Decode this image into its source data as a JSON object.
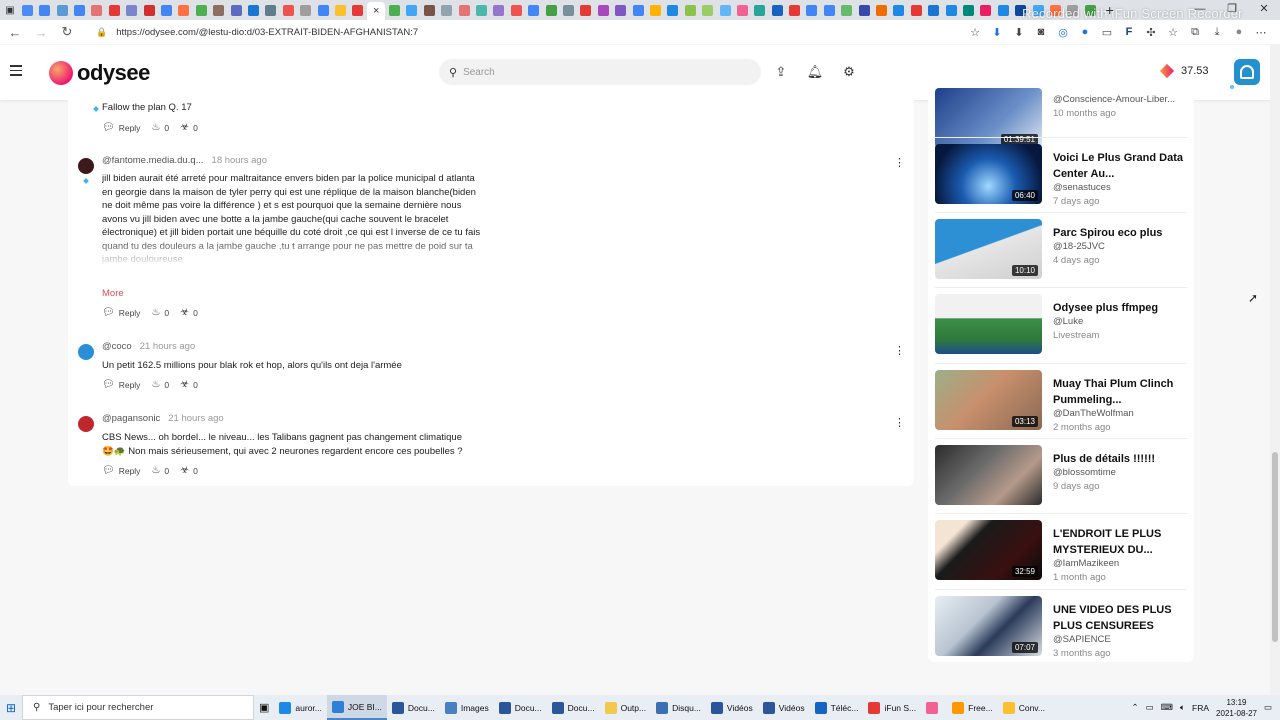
{
  "browser": {
    "tab_colors": [
      "#4c8bf5",
      "#4285f4",
      "#5b9bd5",
      "#4285f4",
      "#e57373",
      "#e53935",
      "#7986cb",
      "#d32f2f",
      "#4285f4",
      "#ff7043",
      "#4caf50",
      "#8d6e63",
      "#5c6bc0",
      "#1976d2",
      "#607d8b",
      "#ef5350",
      "#9e9e9e",
      "#4285f4",
      "#fbc02d",
      "#e53935",
      "#4caf50",
      "#42a5f5",
      "#795548",
      "#90a4ae",
      "#e57373",
      "#4db6ac",
      "#9575cd",
      "#ef5350",
      "#4285f4",
      "#43a047",
      "#78909c",
      "#e53935",
      "#ab47bc",
      "#7e57c2",
      "#4285f4",
      "#ffb300",
      "#1e88e5",
      "#8bc34a",
      "#9ccc65",
      "#64b5f6",
      "#f06292",
      "#26a69a",
      "#1565c0",
      "#e53935",
      "#4285f4",
      "#4285f4",
      "#66bb6a",
      "#3949ab",
      "#ef6c00",
      "#1e88e5",
      "#e53935",
      "#1976d2",
      "#1e88e5",
      "#00897b",
      "#e91e63",
      "#1e88e5",
      "#0d47a1",
      "#42a5f5",
      "#ff7043",
      "#9e9e9e",
      "#43a047"
    ],
    "tab_close": "×",
    "new_tab": "+",
    "recorder_watermark": "Recorded with iFun Screen Recorder",
    "url": "https://odysee.com/@lestu-dio:d/03-EXTRAIT-BIDEN-AFGHANISTAN:7",
    "window_controls": [
      "—",
      "❐",
      "✕"
    ]
  },
  "header": {
    "logo_text": "odysee",
    "search_placeholder": "Search",
    "credits": "37.53"
  },
  "comments": [
    {
      "author": "",
      "time": "",
      "text": "Fallow the plan Q. 17",
      "reply_label": "Reply",
      "likes": "0",
      "dislikes": "0"
    },
    {
      "author": "@fantome.media.du.q...",
      "time": "18 hours ago",
      "text": "jill biden aurait été arreté pour maltraitance envers biden par la police municipal d atlanta en georgie dans la maison de tyler perry qui est une réplique de la maison blanche(biden ne doit même pas voire la différence ) et s est pourquoi que la semaine dernière nous avons vu jill biden avec une botte a la jambe gauche(qui cache souvent le bracelet électronique) et jill biden portait une béquille du coté droit ,ce qui est l inverse de ce tu fais quand tu des douleurs a la jambe gauche ,tu t arrange pour ne pas mettre de poid sur ta jambe douloureuse",
      "more_label": "More",
      "reply_label": "Reply",
      "likes": "0",
      "dislikes": "0",
      "avatar_color": "#3a1a1a"
    },
    {
      "author": "@coco",
      "time": "21 hours ago",
      "text": "Un petit 162.5 millions pour blak rok et hop, alors qu'ils ont deja l'armée",
      "reply_label": "Reply",
      "likes": "0",
      "dislikes": "0",
      "avatar_color": "#2a8fd8"
    },
    {
      "author": "@pagansonic",
      "time": "21 hours ago",
      "text_line1": "CBS News... oh bordel... le niveau... les Talibans gagnent pas changement climatique",
      "text_line2": "🤩🐢 Non mais sérieusement, qui avec 2 neurones regardent encore ces poubelles ?",
      "reply_label": "Reply",
      "likes": "0",
      "dislikes": "0",
      "avatar_color": "#c0262d"
    }
  ],
  "related": [
    {
      "title": "",
      "channel": "@Conscience-Amour-Liber...",
      "age": "10 months ago",
      "duration": "01:39:51",
      "thumb": "linear-gradient(135deg,#1e3f8a,#6a8fc8 60%,#dfe6f1)"
    },
    {
      "title": "Voici Le Plus Grand Data Center Au...",
      "channel": "@senastuces",
      "age": "7 days ago",
      "duration": "06:40",
      "thumb": "radial-gradient(circle at 50% 70%,#9fd8ff,#1a5bb0 40%,#07183e 80%)"
    },
    {
      "title": "Parc Spirou eco plus",
      "channel": "@18-25JVC",
      "age": "4 days ago",
      "duration": "10:10",
      "thumb": "linear-gradient(160deg,#2d8fd4 45%,#e6e6e6 46%,#cfcfcf)"
    },
    {
      "title": "Odysee plus ffmpeg",
      "channel": "@Luke",
      "age": "Livestream",
      "duration": "",
      "thumb": "linear-gradient(180deg,#f1f1f1 40%,#3a8f46 41%,#2f7a3a 75%,#1c4f8a)"
    },
    {
      "title": "Muay Thai Plum Clinch Pummeling...",
      "channel": "@DanTheWolfman",
      "age": "2 months ago",
      "duration": "03:13",
      "thumb": "linear-gradient(135deg,#9bb08a,#c98f6c 45%,#8a6a55)"
    },
    {
      "title": "Plus de détails !!!!!!",
      "channel": "@blossomtime",
      "age": "9 days ago",
      "duration": "",
      "thumb": "linear-gradient(135deg,#2b2b2b,#6b6b6b 40%,#b59a8a 70%,#2b2b2b)"
    },
    {
      "title": "L'ENDROIT LE PLUS MYSTERIEUX DU...",
      "channel": "@IamMazikeen",
      "age": "1 month ago",
      "duration": "32:59",
      "thumb": "linear-gradient(135deg,#f4e4d4 20%,#1a1a1a 35%,#3a1010 70%,#0a0a0a)"
    },
    {
      "title": "UNE VIDEO DES PLUS PLUS CENSUREES",
      "channel": "@SAPIENCE",
      "age": "3 months ago",
      "duration": "07:07",
      "thumb": "linear-gradient(135deg,#e8eef4,#b8c4d0 40%,#2a3a5a 60%,#d8dde3)"
    }
  ],
  "taskbar": {
    "search_placeholder": "Taper ici pour rechercher",
    "apps": [
      {
        "label": "auror...",
        "color": "#1e88e5",
        "active": false
      },
      {
        "label": "JOE BI...",
        "color": "#2f7ed8",
        "active": true
      },
      {
        "label": "Docu...",
        "color": "#2b579a",
        "active": false
      },
      {
        "label": "Images",
        "color": "#4a7fc1",
        "active": false
      },
      {
        "label": "Docu...",
        "color": "#2b579a",
        "active": false
      },
      {
        "label": "Docu...",
        "color": "#2b579a",
        "active": false
      },
      {
        "label": "Outp...",
        "color": "#f2c94c",
        "active": false
      },
      {
        "label": "Disqu...",
        "color": "#3c6eb4",
        "active": false
      },
      {
        "label": "Vidéos",
        "color": "#2b579a",
        "active": false
      },
      {
        "label": "Vidéos",
        "color": "#2b579a",
        "active": false
      },
      {
        "label": "Téléc...",
        "color": "#1565c0",
        "active": false
      },
      {
        "label": "iFun S...",
        "color": "#e53935",
        "active": false
      },
      {
        "label": "",
        "color": "#f06292",
        "active": false
      },
      {
        "label": "Free...",
        "color": "#ff9800",
        "active": false
      },
      {
        "label": "Conv...",
        "color": "#fbc02d",
        "active": false
      }
    ],
    "language": "FRA",
    "time": "13:19",
    "date": "2021-08-27"
  }
}
